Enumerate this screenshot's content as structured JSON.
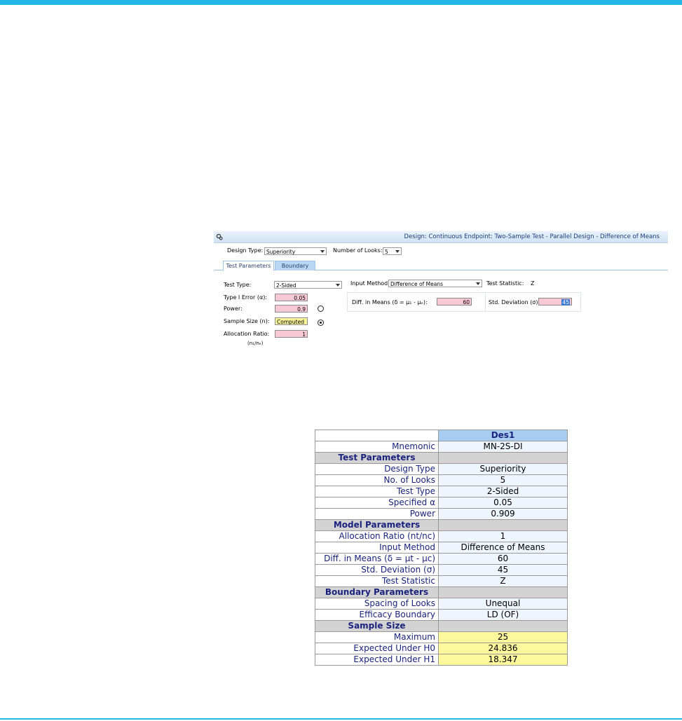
{
  "dialog": {
    "title": "Design: Continuous Endpoint: Two-Sample Test - Parallel Design - Difference of Means",
    "design_type_label": "Design Type:",
    "design_type_value": "Superiority",
    "num_looks_label": "Number of Looks:",
    "num_looks_value": "5",
    "tabs": [
      "Test Parameters",
      "Boundary"
    ],
    "test_type_label": "Test Type:",
    "test_type_value": "2-Sided",
    "type1_label": "Type I Error (α):",
    "type1_value": "0.05",
    "power_label": "Power:",
    "power_value": "0.9",
    "sample_size_label": "Sample Size (n):",
    "sample_size_value": "Computed",
    "alloc_label": "Allocation Ratio:",
    "alloc_sub": "(n₁/nₑ)",
    "alloc_value": "1",
    "input_method_label": "Input Method:",
    "input_method_value": "Difference of Means",
    "test_stat_label": "Test Statistic:",
    "test_stat_value": "Z",
    "diff_means_label": "Diff. in Means (δ = μ₁ - μₑ):",
    "diff_means_value": "60",
    "std_dev_label": "Std. Deviation (σ):",
    "std_dev_value": "45"
  },
  "table": {
    "header": "Des1",
    "rows": [
      {
        "type": "row",
        "label": "Mnemonic",
        "value": "MN-2S-DI"
      },
      {
        "type": "section",
        "label": "Test Parameters"
      },
      {
        "type": "row",
        "label": "Design Type",
        "value": "Superiority"
      },
      {
        "type": "row",
        "label": "No. of Looks",
        "value": "5"
      },
      {
        "type": "row",
        "label": "Test Type",
        "value": "2-Sided"
      },
      {
        "type": "row",
        "label": "Specified α",
        "value": "0.05"
      },
      {
        "type": "row",
        "label": "Power",
        "value": "0.909"
      },
      {
        "type": "section",
        "label": "Model Parameters"
      },
      {
        "type": "row",
        "label": "Allocation Ratio (nt/nc)",
        "value": "1"
      },
      {
        "type": "row",
        "label": "Input Method",
        "value": "Difference of Means"
      },
      {
        "type": "row",
        "label": "Diff. in Means (δ = μt - μc)",
        "value": "60"
      },
      {
        "type": "row",
        "label": "Std. Deviation (σ)",
        "value": "45"
      },
      {
        "type": "row",
        "label": "Test Statistic",
        "value": "Z"
      },
      {
        "type": "section",
        "label": "Boundary Parameters"
      },
      {
        "type": "row",
        "label": "Spacing of Looks",
        "value": "Unequal"
      },
      {
        "type": "row",
        "label": "Efficacy Boundary",
        "value": "LD (OF)"
      },
      {
        "type": "section",
        "label": "Sample Size"
      },
      {
        "type": "row",
        "label": "Maximum",
        "value": "25",
        "highlight": true
      },
      {
        "type": "row",
        "label": "Expected Under H0",
        "value": "24.836",
        "highlight": true
      },
      {
        "type": "row",
        "label": "Expected Under H1",
        "value": "18.347",
        "highlight": true
      }
    ]
  },
  "colors": {
    "accent": "#22b5e8",
    "input_pink": "#f8c8d4",
    "computed_yellow": "#fbf59a",
    "table_header": "#a9cdf0"
  }
}
